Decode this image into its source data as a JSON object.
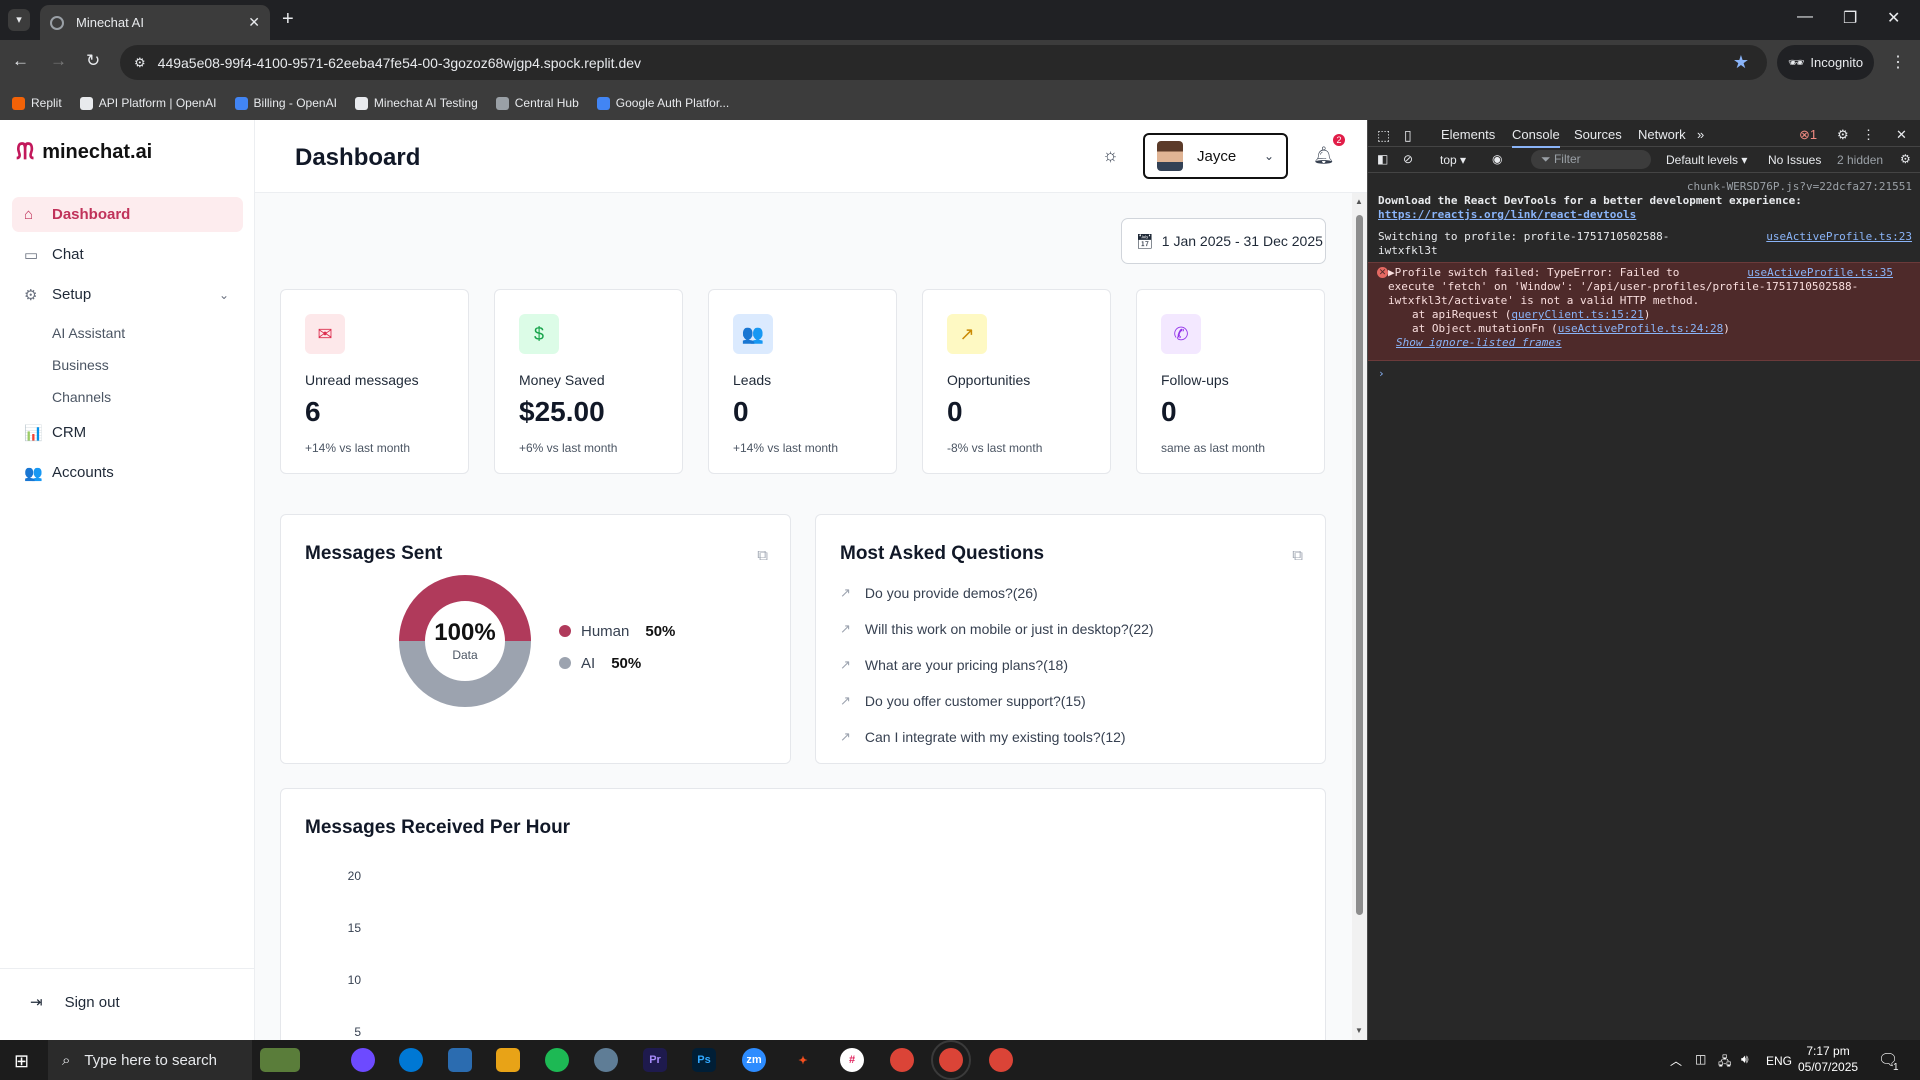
{
  "browser": {
    "tab_title": "Minechat AI",
    "url": "449a5e08-99f4-4100-9571-62eeba47fe54-00-3gozoz68wjgp4.spock.replit.dev",
    "incognito_label": "Incognito",
    "bookmarks": [
      {
        "label": "Replit",
        "color": "#f26207"
      },
      {
        "label": "API Platform | OpenAI",
        "color": "#e8eaed"
      },
      {
        "label": "Billing - OpenAI",
        "color": "#4285f4"
      },
      {
        "label": "Minechat AI Testing",
        "color": "#e8eaed"
      },
      {
        "label": "Central Hub",
        "color": "#9aa0a6"
      },
      {
        "label": "Google Auth Platfor...",
        "color": "#4285f4"
      }
    ]
  },
  "app": {
    "logo_text": "minechat.ai",
    "nav": {
      "dashboard": "Dashboard",
      "chat": "Chat",
      "setup": "Setup",
      "ai_assistant": "AI Assistant",
      "business": "Business",
      "channels": "Channels",
      "crm": "CRM",
      "accounts": "Accounts"
    },
    "sign_out": "Sign out",
    "page_title": "Dashboard",
    "user_name": "Jayce",
    "notification_count": "2",
    "date_range": "1 Jan 2025 - 31 Dec 2025",
    "stats": [
      {
        "label": "Unread messages",
        "value": "6",
        "change": "+14% vs last month",
        "icon": "mail-icon",
        "glyph": "✉",
        "bg": "#fde8ea",
        "fg": "#dc2f4f"
      },
      {
        "label": "Money Saved",
        "value": "$25.00",
        "change": "+6% vs last month",
        "icon": "dollar-icon",
        "glyph": "$",
        "bg": "#dcfce7",
        "fg": "#16a34a"
      },
      {
        "label": "Leads",
        "value": "0",
        "change": "+14% vs last month",
        "icon": "users-icon",
        "glyph": "👥",
        "bg": "#dbeafe",
        "fg": "#2563eb"
      },
      {
        "label": "Opportunities",
        "value": "0",
        "change": "-8% vs last month",
        "icon": "trending-up-icon",
        "glyph": "↗",
        "bg": "#fef9c3",
        "fg": "#ca8a04"
      },
      {
        "label": "Follow-ups",
        "value": "0",
        "change": "same as last month",
        "icon": "phone-icon",
        "glyph": "✆",
        "bg": "#f3e8ff",
        "fg": "#9333ea"
      }
    ],
    "messages_sent": {
      "title": "Messages Sent",
      "center_value": "100%",
      "center_label": "Data",
      "legend": [
        {
          "label": "Human",
          "pct": "50%",
          "color": "#b03a5b"
        },
        {
          "label": "AI",
          "pct": "50%",
          "color": "#9ca3af"
        }
      ]
    },
    "most_asked": {
      "title": "Most Asked Questions",
      "questions": [
        "Do you provide demos?(26)",
        "Will this work on mobile or just in desktop?(22)",
        "What are your pricing plans?(18)",
        "Do you offer customer support?(15)",
        "Can I integrate with my existing tools?(12)"
      ]
    },
    "per_hour": {
      "title": "Messages Received Per Hour",
      "y_ticks": [
        "20",
        "15",
        "10",
        "5"
      ]
    }
  },
  "chart_data": {
    "type": "pie",
    "title": "Messages Sent",
    "categories": [
      "Human",
      "AI"
    ],
    "values": [
      50,
      50
    ],
    "colors": [
      "#b03a5b",
      "#9ca3af"
    ]
  },
  "devtools": {
    "tabs": {
      "elements": "Elements",
      "console": "Console",
      "sources": "Sources",
      "network": "Network"
    },
    "error_count": "1",
    "context": "top",
    "filter_placeholder": "Filter",
    "levels": "Default levels",
    "issues": "No Issues",
    "hidden": "2 hidden",
    "source_top": "chunk-WERSD76P.js?v=22dcfa27:21551",
    "react_msg": "Download the React DevTools for a better development experience:",
    "react_link": "https://reactjs.org/link/react-devtools",
    "switch_msg_1": "Switching to profile: profile-1751710502588-",
    "switch_msg_2": "iwtxfkl3t",
    "switch_src": "useActiveProfile.ts:23",
    "err_1": "▶Profile switch failed: TypeError: Failed to",
    "err_src": "useActiveProfile.ts:35",
    "err_2": "execute 'fetch' on 'Window': '/api/user-profiles/profile-1751710502588-",
    "err_3": "iwtxfkl3t/activate' is not a valid HTTP method.",
    "err_4a": "at apiRequest (",
    "err_4link": "queryClient.ts:15:21",
    "err_5a": "at Object.mutationFn (",
    "err_5link": "useActiveProfile.ts:24:28",
    "err_6": "Show ignore-listed frames"
  },
  "taskbar": {
    "search_placeholder": "Type here to search",
    "lang": "ENG",
    "time": "7:17 pm",
    "date": "05/07/2025",
    "notif_count": "1"
  }
}
